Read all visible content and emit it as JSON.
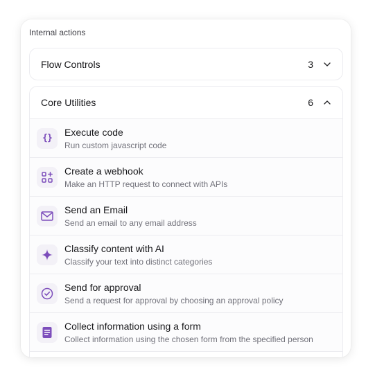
{
  "panel": {
    "section_label": "Internal actions"
  },
  "groups": [
    {
      "title": "Flow Controls",
      "count": "3",
      "expanded": false
    },
    {
      "title": "Core Utilities",
      "count": "6",
      "expanded": true,
      "items": [
        {
          "title": "Execute code",
          "description": "Run custom javascript code",
          "icon": "code-braces-icon"
        },
        {
          "title": "Create a webhook",
          "description": "Make an HTTP request to connect with APIs",
          "icon": "webhook-icon"
        },
        {
          "title": "Send an Email",
          "description": "Send an email to any email address",
          "icon": "mail-icon"
        },
        {
          "title": "Classify content with AI",
          "description": "Classify your text into distinct categories",
          "icon": "sparkle-icon"
        },
        {
          "title": "Send for approval",
          "description": "Send a request for approval by choosing an approval policy",
          "icon": "check-circle-icon"
        },
        {
          "title": "Collect information using a form",
          "description": "Collect information using the chosen form from the specified person",
          "icon": "form-icon"
        }
      ]
    }
  ],
  "colors": {
    "accent": "#7c4dbb",
    "icon_bg": "#f3f1f7"
  }
}
